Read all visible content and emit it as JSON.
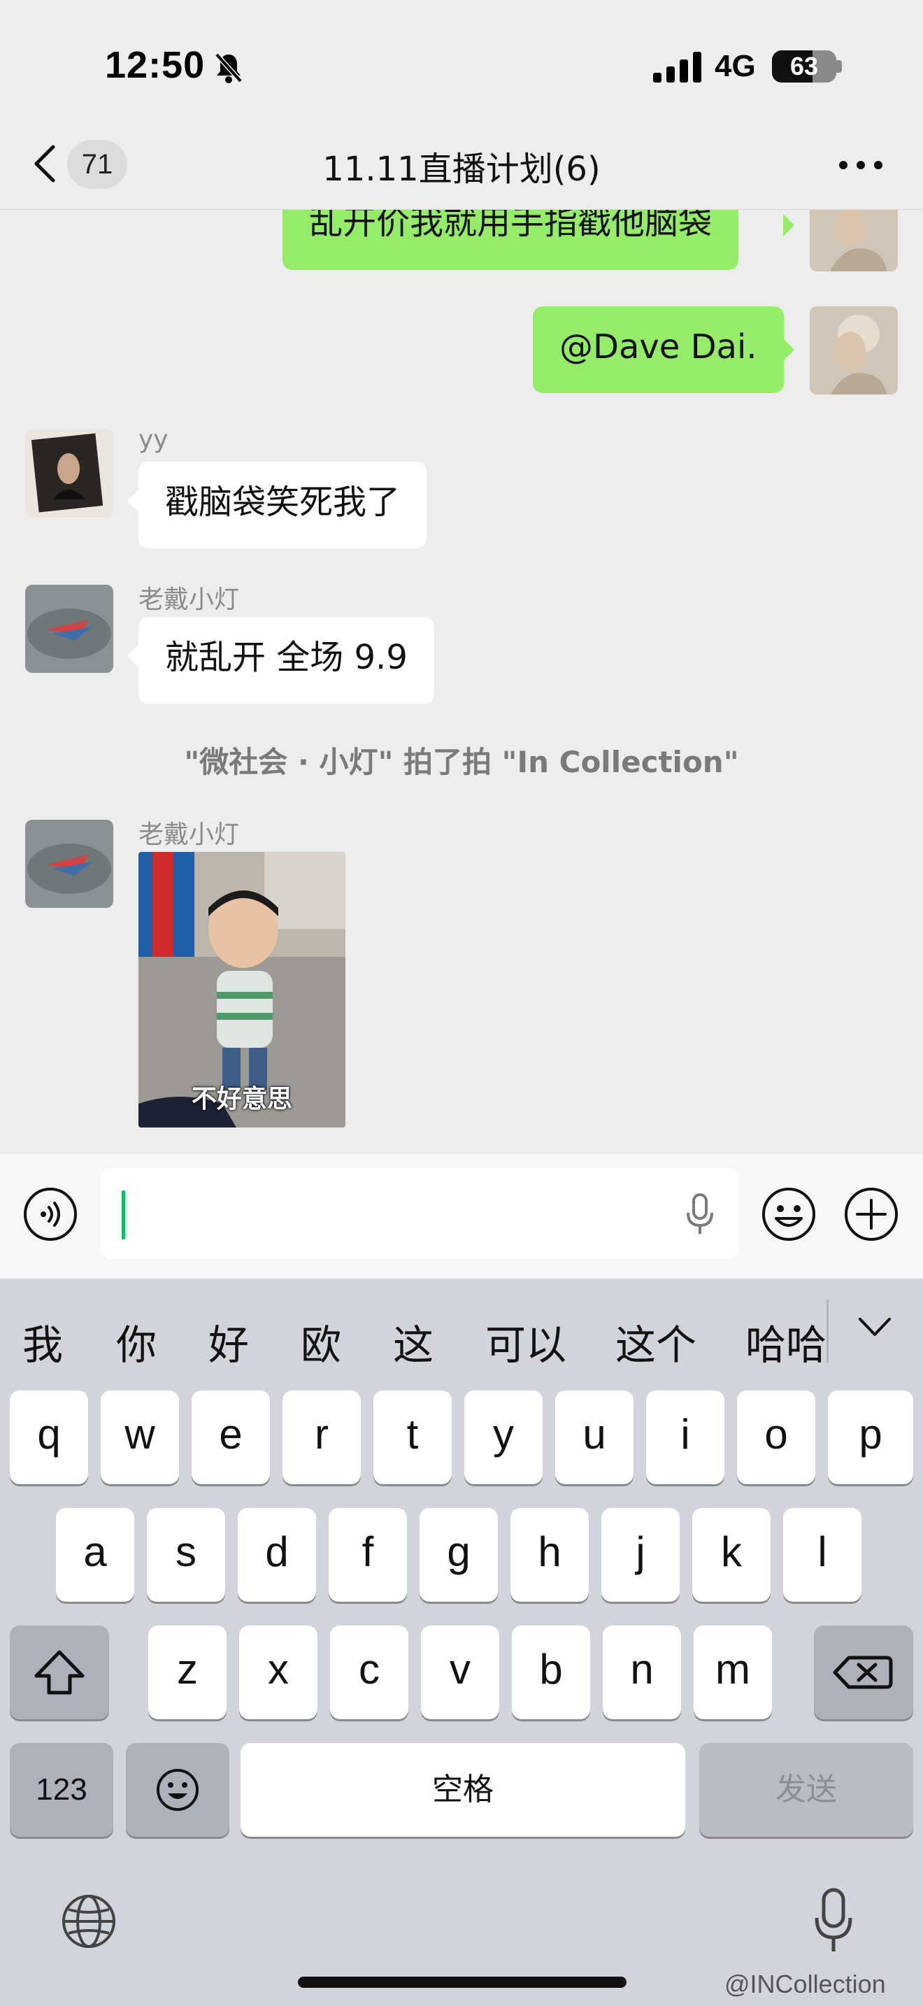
{
  "status_bar": {
    "time": "12:50",
    "network": "4G",
    "battery": "63",
    "battery_level": 0.63
  },
  "nav": {
    "back_count": "71",
    "title": "11.11直播计划(6)"
  },
  "messages": [
    {
      "side": "right",
      "text": "乱开价我就用手指戳他脑袋"
    },
    {
      "side": "right",
      "text": "@Dave Dai."
    },
    {
      "side": "left",
      "sender": "yy",
      "text": "戳脑袋笑死我了"
    },
    {
      "side": "left",
      "sender": "老戴小灯",
      "text": "就乱开 全场 9.9"
    }
  ],
  "system_note": "\"微社会 · 小灯\" 拍了拍 \"In Collection\"",
  "image_message": {
    "sender": "老戴小灯",
    "caption": "不好意思"
  },
  "candidates": [
    "我",
    "你",
    "好",
    "欧",
    "这",
    "可以",
    "这个",
    "哈哈"
  ],
  "keyboard": {
    "row1": [
      "q",
      "w",
      "e",
      "r",
      "t",
      "y",
      "u",
      "i",
      "o",
      "p"
    ],
    "row2": [
      "a",
      "s",
      "d",
      "f",
      "g",
      "h",
      "j",
      "k",
      "l"
    ],
    "row3": [
      "z",
      "x",
      "c",
      "v",
      "b",
      "n",
      "m"
    ],
    "numbers_label": "123",
    "space_label": "空格",
    "send_label": "发送"
  },
  "watermark": "@INCollection",
  "colors": {
    "background": "#ededed",
    "sent_bubble": "#95ec69",
    "received_bubble": "#ffffff",
    "caret": "#07c160",
    "keyboard_bg": "#d1d4da"
  }
}
